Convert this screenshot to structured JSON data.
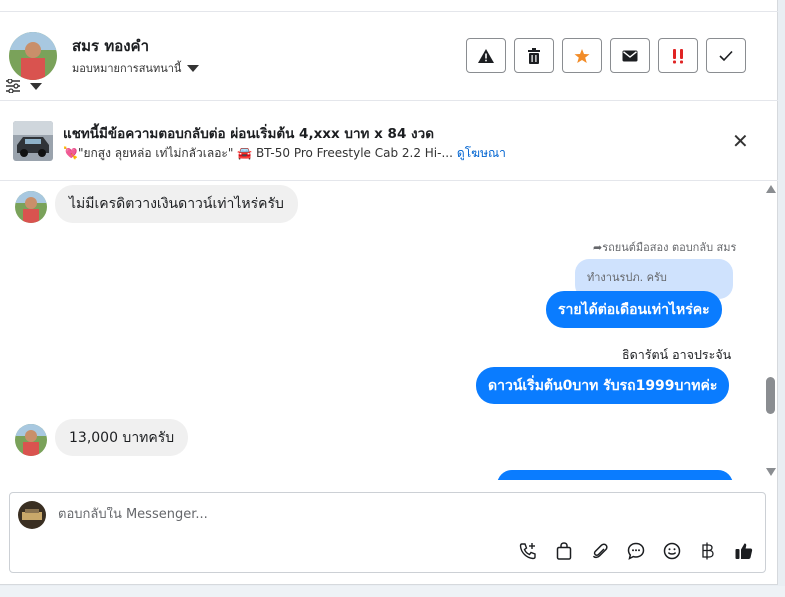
{
  "header": {
    "contact_name": "สมร ทองคำ",
    "assign_label": "มอบหมายการสนทนานี้",
    "actions": [
      {
        "icon": "warning-icon",
        "glyph": "⚠"
      },
      {
        "icon": "trash-icon",
        "glyph": "🗑"
      },
      {
        "icon": "star-icon",
        "glyph": "★",
        "color": "#f28c28"
      },
      {
        "icon": "envelope-icon",
        "glyph": "✉"
      },
      {
        "icon": "priority-icon",
        "glyph": "‼",
        "color": "#e02424"
      },
      {
        "icon": "check-icon",
        "glyph": "✓"
      }
    ]
  },
  "ad": {
    "title": "แชทนี้มีข้อความตอบกลับต่อ ผ่อนเริ่มต้น 4,xxx บาท x 84 งวด",
    "subtitle": "💘\"ยกสูง ลุยหล่อ เท่ไม่กลัวเลอะ\" 🚘 BT-50 Pro Freestyle Cab 2.2 Hi-...",
    "link": "ดูโฆษณา"
  },
  "messages": {
    "m1": "ไม่มีเครดิตวางเงินดาวน์เท่าไหร่ครับ",
    "reply_meta": "รถยนต์มือสอง ตอบกลับ สมร",
    "quoted": "ทำงานรปภ. ครับ",
    "m2": "รายได้ต่อเดือนเท่าไหร่คะ",
    "sender": "ธิดารัตน์ อาจประจัน",
    "m3": "ดาวน์เริ่มต้น0บาท รับรถ1999บาทค่ะ",
    "m4": "13,000 บาทครับ"
  },
  "composer": {
    "placeholder": "ตอบกลับใน Messenger...",
    "tools": [
      "call-add-icon",
      "shopping-bag-icon",
      "paperclip-icon",
      "chat-bubble-icon",
      "emoji-icon",
      "baht-icon",
      "thumbs-up-icon"
    ]
  },
  "colors": {
    "accent": "#0a7cff",
    "incoming_bubble": "#f0f0f0",
    "quoted_bubble": "#cfe2fd",
    "link": "#0064d1"
  }
}
